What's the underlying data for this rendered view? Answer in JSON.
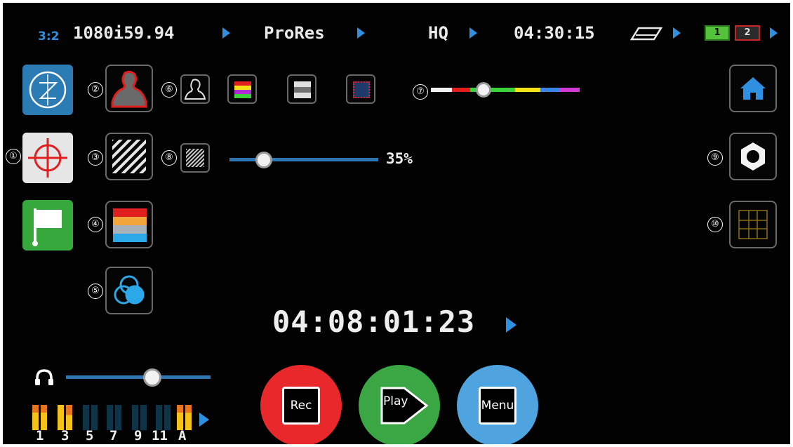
{
  "top_bar": {
    "pulldown": "3:2",
    "format": "1080i59.94",
    "codec": "ProRes",
    "quality": "HQ",
    "time_remaining": "04:30:15",
    "battery_slot_1": "1",
    "battery_slot_2": "2"
  },
  "annotations": [
    "①",
    "②",
    "③",
    "④",
    "⑤",
    "⑥",
    "⑦",
    "⑧",
    "⑨",
    "⑩"
  ],
  "zebra_level": "35%",
  "zebra_level_value": 0.35,
  "timecode": "04:08:01:23",
  "buttons": {
    "rec": "Rec",
    "play": "Play",
    "menu": "Menu"
  },
  "audio": {
    "volume_fraction": 0.59,
    "channels": [
      "1",
      "3",
      "5",
      "7",
      "9",
      "11",
      "A"
    ]
  },
  "colors": {
    "accent_blue": "#2f8fe0",
    "record_red": "#e8282a",
    "play_green": "#3aa744",
    "menu_blue": "#4fa3de",
    "focus_peaking_red": "#e21f1f"
  }
}
